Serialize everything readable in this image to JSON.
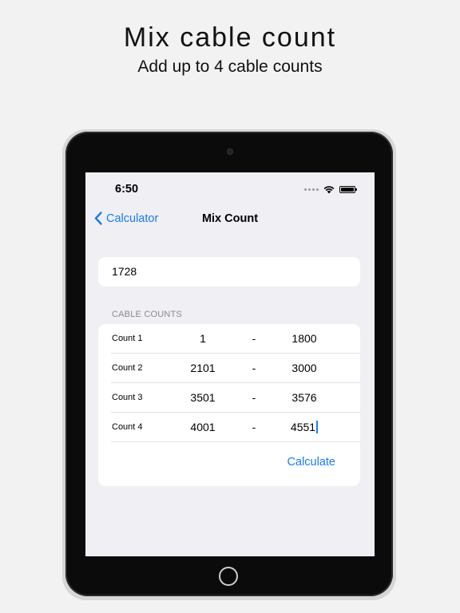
{
  "headline": "Mix cable count",
  "subheadline": "Add up to 4 cable counts",
  "status_bar": {
    "time": "6:50"
  },
  "nav": {
    "back_label": "Calculator",
    "title": "Mix Count"
  },
  "total_field": {
    "value": "1728"
  },
  "section_header": "CABLE COUNTS",
  "counts": [
    {
      "label": "Count 1",
      "from": "1",
      "to": "1800"
    },
    {
      "label": "Count 2",
      "from": "2101",
      "to": "3000"
    },
    {
      "label": "Count 3",
      "from": "3501",
      "to": "3576"
    },
    {
      "label": "Count 4",
      "from": "4001",
      "to": "4551"
    }
  ],
  "separator": "-",
  "calculate_label": "Calculate",
  "colors": {
    "accent": "#1a7cf0",
    "background": "#efeff4",
    "card": "#ffffff"
  }
}
